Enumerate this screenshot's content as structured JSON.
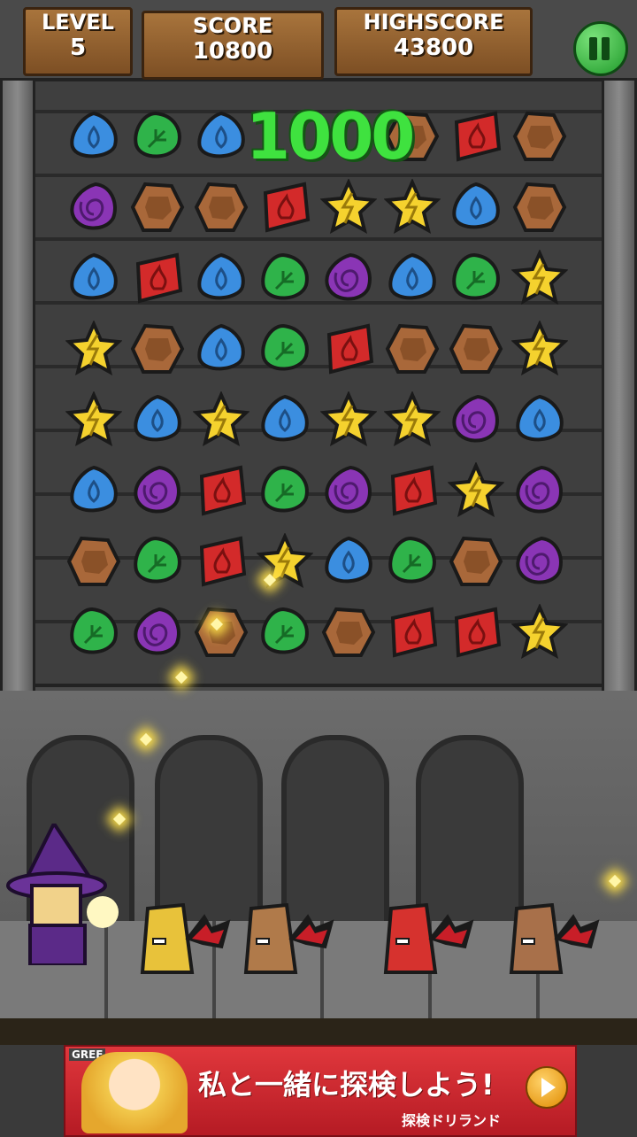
{
  "hud": {
    "level_label": "LEVEL",
    "level_value": "5",
    "score_label": "SCORE",
    "score_value": "10800",
    "highscore_label": "HIGHSCORE",
    "highscore_value": "43800",
    "pause_icon": "pause-icon"
  },
  "score_popup": "1000",
  "board": {
    "columns": 8,
    "rows": 8,
    "gem_types": {
      "blue": {
        "name": "water-drop-gem",
        "color": "#3b8ee0"
      },
      "green": {
        "name": "leaf-gem",
        "color": "#2fb34a"
      },
      "red": {
        "name": "fire-gem",
        "color": "#d32a2a"
      },
      "brown": {
        "name": "rock-gem",
        "color": "#a9683a"
      },
      "purple": {
        "name": "swirl-gem",
        "color": "#8a35b5"
      },
      "yellow": {
        "name": "lightning-star-gem",
        "color": "#f5d22e"
      }
    },
    "grid": [
      [
        "blue",
        "green",
        "blue",
        null,
        null,
        "brown",
        "red",
        "brown"
      ],
      [
        "purple",
        "brown",
        "brown",
        "red",
        "yellow",
        "yellow",
        "blue",
        "brown"
      ],
      [
        "blue",
        "red",
        "blue",
        "green",
        "purple",
        "blue",
        "green",
        "yellow"
      ],
      [
        "yellow",
        "brown",
        "blue",
        "green",
        "red",
        "brown",
        "brown",
        "yellow"
      ],
      [
        "yellow",
        "blue",
        "yellow",
        "blue",
        "yellow",
        "yellow",
        "purple",
        "blue"
      ],
      [
        "blue",
        "purple",
        "red",
        "green",
        "purple",
        "red",
        "yellow",
        "purple"
      ],
      [
        "brown",
        "green",
        "red",
        "yellow",
        "blue",
        "green",
        "brown",
        "purple"
      ],
      [
        "green",
        "purple",
        "brown",
        "green",
        "brown",
        "red",
        "red",
        "yellow"
      ]
    ]
  },
  "characters": {
    "wizard": {
      "name": "wizard-player"
    },
    "enemies": [
      {
        "name": "yellow-bat-enemy",
        "color": "#e8c23a"
      },
      {
        "name": "brown-bat-enemy",
        "color": "#b07a4a"
      },
      {
        "name": "red-bat-enemy",
        "color": "#d6322e"
      },
      {
        "name": "brown-bat-enemy-2",
        "color": "#a8704a"
      }
    ]
  },
  "ad": {
    "brand": "GREE",
    "headline": "私と一緒に探検しよう!",
    "subline": "探検ドリランド"
  }
}
